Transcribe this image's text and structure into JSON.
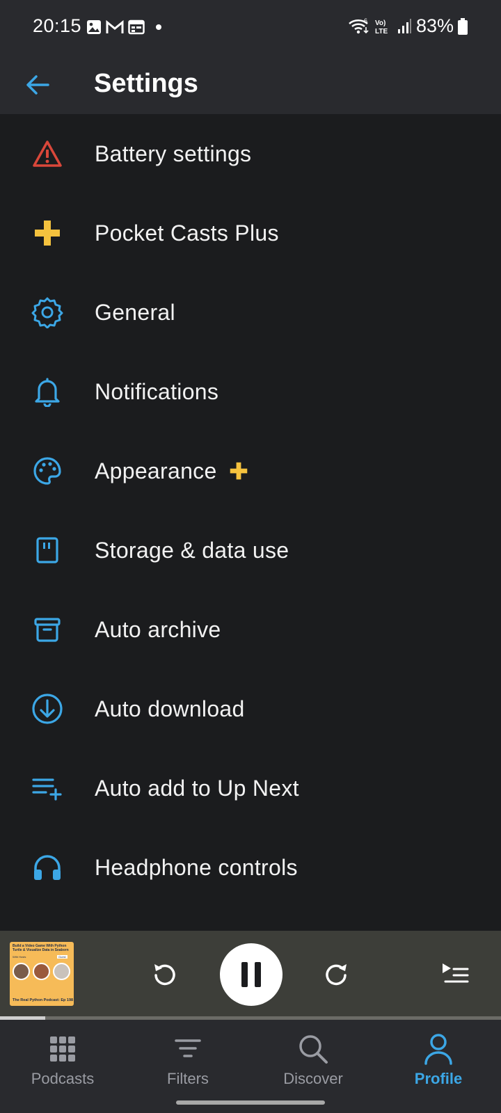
{
  "status_bar": {
    "time": "20:15",
    "battery": "83%",
    "network": "LTE",
    "icons": [
      "gallery-icon",
      "gmail-icon",
      "calendar-icon",
      "dot-icon",
      "wifi-icon",
      "volte-icon",
      "signal-icon",
      "battery-icon"
    ]
  },
  "header": {
    "title": "Settings",
    "back_icon": "arrow-left-icon"
  },
  "settings": {
    "items": [
      {
        "label": "Battery settings",
        "icon": "warning-icon",
        "color": "#d9473a"
      },
      {
        "label": "Pocket Casts Plus",
        "icon": "plus-icon",
        "color": "#f5c23e"
      },
      {
        "label": "General",
        "icon": "gear-icon",
        "color": "#3ca7e6"
      },
      {
        "label": "Notifications",
        "icon": "bell-icon",
        "color": "#3ca7e6"
      },
      {
        "label": "Appearance",
        "icon": "palette-icon",
        "color": "#3ca7e6",
        "badge": "plus-icon"
      },
      {
        "label": "Storage & data use",
        "icon": "sd-card-icon",
        "color": "#3ca7e6"
      },
      {
        "label": "Auto archive",
        "icon": "archive-icon",
        "color": "#3ca7e6"
      },
      {
        "label": "Auto download",
        "icon": "download-icon",
        "color": "#3ca7e6"
      },
      {
        "label": "Auto add to Up Next",
        "icon": "playlist-add-icon",
        "color": "#3ca7e6"
      },
      {
        "label": "Headphone controls",
        "icon": "headphones-icon",
        "color": "#3ca7e6"
      }
    ]
  },
  "mini_player": {
    "artwork": {
      "title": "Build a Video Game With Python Turtle & Visualize Data in Seaborn",
      "with_hosts": "With Hosts",
      "guest": "Guest",
      "footer": "The Real Python Podcast: Ep 198"
    },
    "progress": 0.09,
    "icons": [
      "skip-back-icon",
      "pause-icon",
      "skip-forward-icon",
      "up-next-icon"
    ]
  },
  "bottom_nav": {
    "items": [
      {
        "label": "Podcasts",
        "icon": "grid-icon",
        "active": false
      },
      {
        "label": "Filters",
        "icon": "filter-icon",
        "active": false
      },
      {
        "label": "Discover",
        "icon": "search-icon",
        "active": false
      },
      {
        "label": "Profile",
        "icon": "profile-icon",
        "active": true
      }
    ]
  },
  "colors": {
    "accent": "#3ca7e6",
    "plus": "#f5c23e",
    "warning": "#d9473a",
    "background": "#1b1c1e",
    "bar": "#292a2e"
  }
}
